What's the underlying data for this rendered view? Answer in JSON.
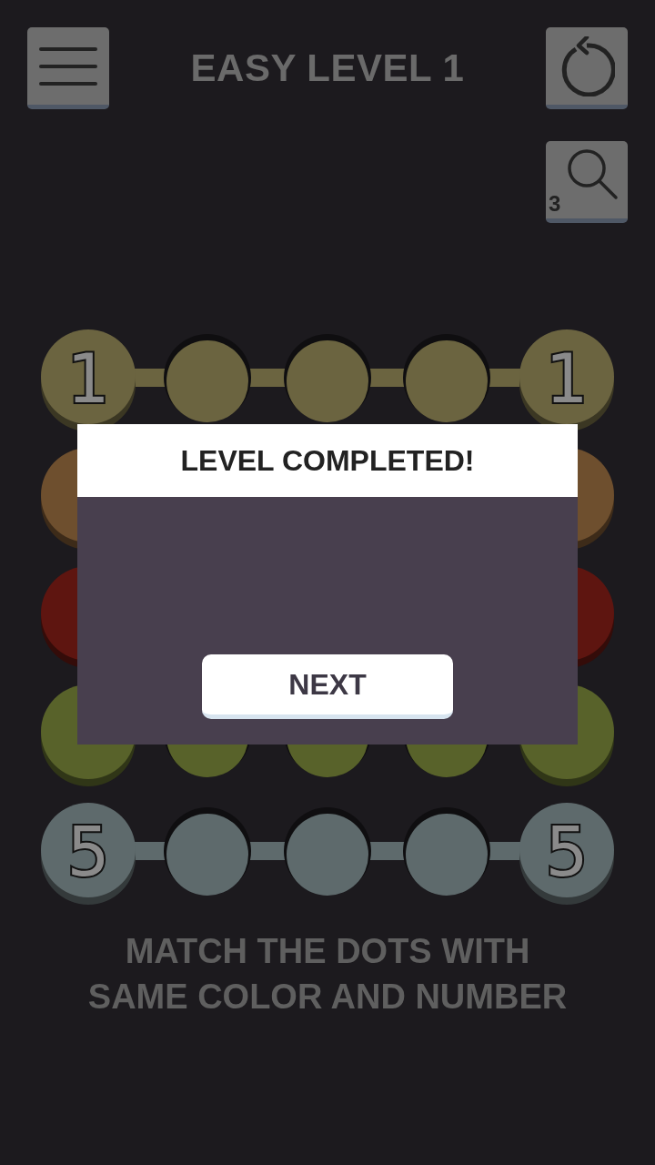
{
  "title": "EASY LEVEL 1",
  "hint": {
    "count": "3"
  },
  "rows": [
    {
      "kind": "full",
      "start_label": "1",
      "end_label": "1",
      "color": "#6b6440",
      "connected": true
    },
    {
      "kind": "ends",
      "color": "#6e4f2e"
    },
    {
      "kind": "ends",
      "color": "#5e1510"
    },
    {
      "kind": "full",
      "color": "#58622a"
    },
    {
      "kind": "full",
      "start_label": "5",
      "end_label": "5",
      "color": "#5e6a6c",
      "connected": true
    }
  ],
  "dialog": {
    "title": "LEVEL COMPLETED!",
    "button": "NEXT"
  },
  "instructions": [
    "MATCH THE DOTS WITH",
    "SAME COLOR AND NUMBER"
  ]
}
